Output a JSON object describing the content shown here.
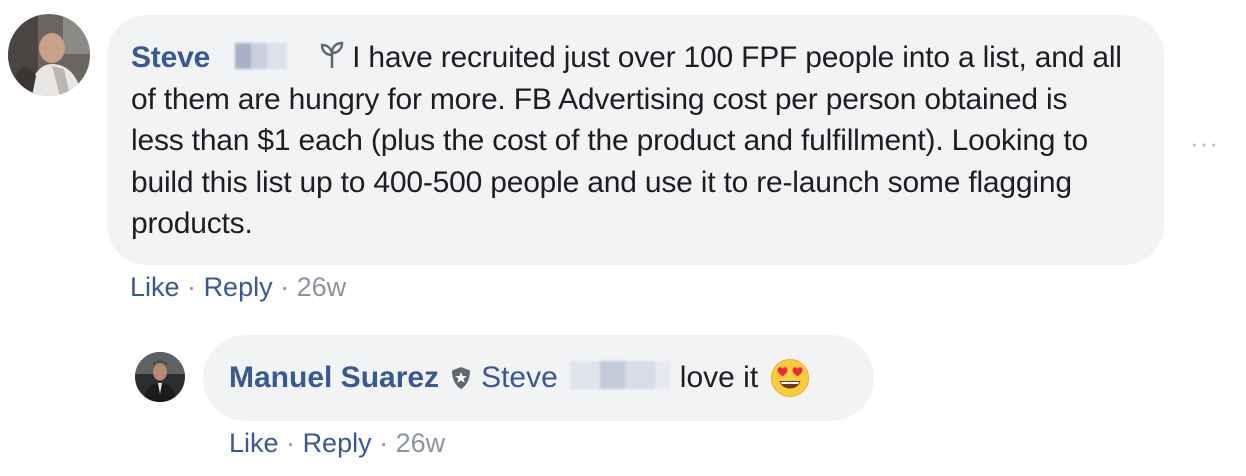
{
  "comment": {
    "author_name": "Steve",
    "text": "I have recruited just over 100 FPF people into a list, and all of them are hungry for more. FB Advertising cost per person obtained is less than $1 each (plus the cost of the product and fulfillment). Looking to build this list up to 400-500 people and use it to re-launch some flagging products.",
    "actions": {
      "like": "Like",
      "reply": "Reply",
      "separator": "·",
      "time": "26w"
    },
    "more_options": "···"
  },
  "reply": {
    "author_name": "Manuel Suarez",
    "mention": "Steve",
    "text": "love it",
    "actions": {
      "like": "Like",
      "reply": "Reply",
      "separator": "·",
      "time": "26w"
    }
  },
  "icons": {
    "author_badge": "sprout-icon",
    "verified_badge": "shield-star-icon",
    "emoji": "heart-eyes-emoji-icon"
  },
  "colors": {
    "link": "#385898",
    "bubble": "#f2f3f5",
    "meta": "#8d949e",
    "text": "#1c1e21"
  }
}
